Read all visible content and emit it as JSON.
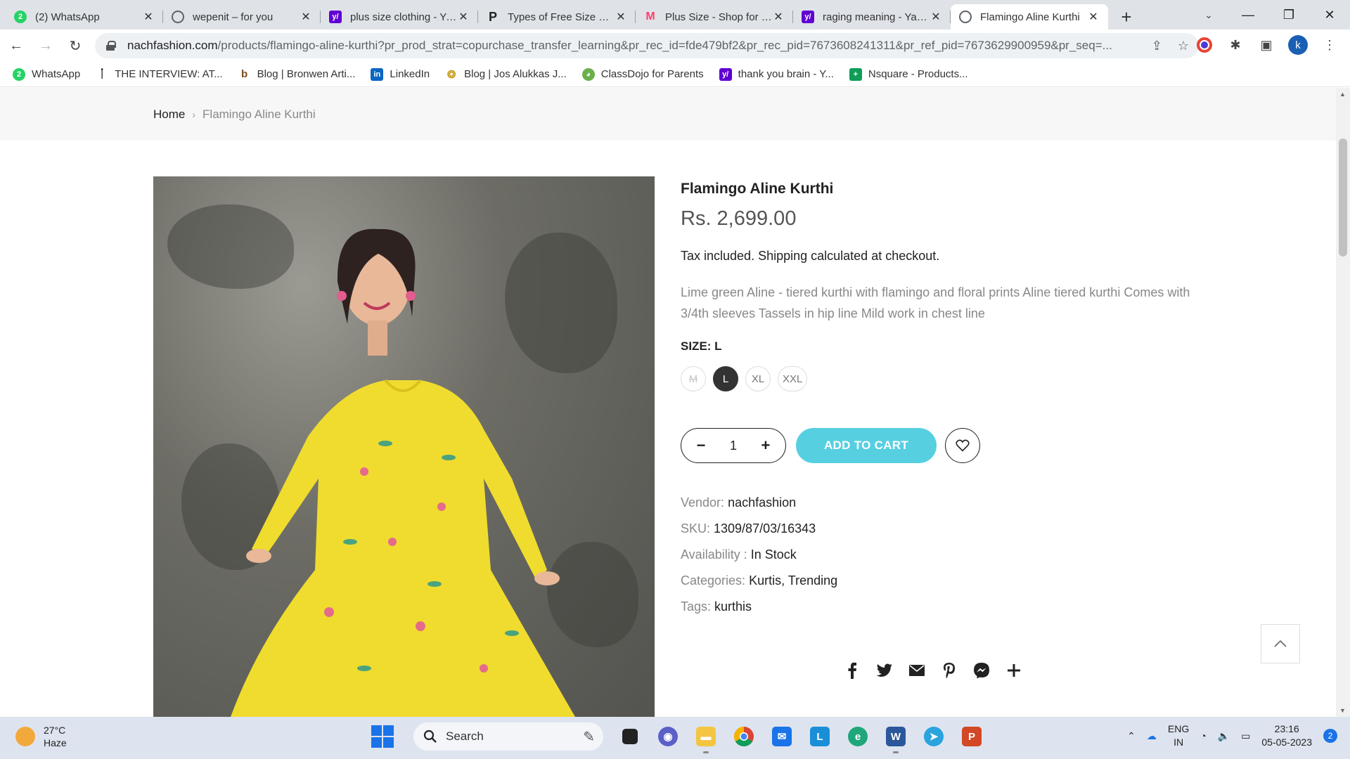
{
  "browser": {
    "tabs": [
      {
        "title": "(2) WhatsApp",
        "favicon": "whatsapp-icon",
        "color": "#25d366"
      },
      {
        "title": "wepenit – for you",
        "favicon": "globe-icon",
        "color": "#5f6368"
      },
      {
        "title": "plus size clothing - Yahoo",
        "favicon": "yahoo-icon",
        "color": "#6001d2"
      },
      {
        "title": "Types of Free Size Kurtis",
        "favicon": "pinterest-icon",
        "color": "#222222"
      },
      {
        "title": "Plus Size - Shop for Plus",
        "favicon": "myntra-icon",
        "color": "#ff3f6c"
      },
      {
        "title": "raging meaning - Yahoo",
        "favicon": "yahoo-icon",
        "color": "#6001d2"
      },
      {
        "title": "Flamingo Aline Kurthi",
        "favicon": "globe-icon",
        "color": "#5f6368"
      }
    ],
    "url_main": "nachfashion.com",
    "url_rest": "/products/flamingo-aline-kurthi?pr_prod_strat=copurchase_transfer_learning&pr_rec_id=fde479bf2&pr_rec_pid=7673608241311&pr_ref_pid=7673629900959&pr_seq=...",
    "profile_initial": "k",
    "bookmarks": [
      {
        "label": "WhatsApp",
        "icon": "whatsapp-icon",
        "color": "#25d366"
      },
      {
        "label": "THE INTERVIEW: AT...",
        "icon": "bottle-icon",
        "color": "#222222"
      },
      {
        "label": "Blog | Bronwen Arti...",
        "icon": "b-icon",
        "color": "#7a4b1e"
      },
      {
        "label": "LinkedIn",
        "icon": "linkedin-icon",
        "color": "#0a66c2"
      },
      {
        "label": "Blog | Jos Alukkas J...",
        "icon": "jewel-icon",
        "color": "#c9a227"
      },
      {
        "label": "ClassDojo for Parents",
        "icon": "classdojo-icon",
        "color": "#6ab04c"
      },
      {
        "label": "thank you brain - Y...",
        "icon": "yahoo-icon",
        "color": "#6001d2"
      },
      {
        "label": "Nsquare - Products...",
        "icon": "nsquare-icon",
        "color": "#0f9d58"
      }
    ]
  },
  "page": {
    "breadcrumb": {
      "home": "Home",
      "sep": "›",
      "current": "Flamingo Aline Kurthi"
    },
    "product": {
      "title": "Flamingo Aline Kurthi",
      "price": "Rs. 2,699.00",
      "tax_note": "Tax included. Shipping calculated at checkout.",
      "description": "Lime green Aline - tiered kurthi with flamingo and floral prints Aline tiered kurthi Comes with 3/4th sleeves Tassels in hip line Mild work in chest line",
      "size_label": "SIZE: L",
      "sizes": [
        {
          "label": "M",
          "state": "sold-out"
        },
        {
          "label": "L",
          "state": "selected"
        },
        {
          "label": "XL",
          "state": "available"
        },
        {
          "label": "XXL",
          "state": "available"
        }
      ],
      "quantity": "1",
      "add_to_cart": "ADD TO CART",
      "accent_color": "#56cfe1",
      "meta": {
        "vendor_key": "Vendor:",
        "vendor_val": "nachfashion",
        "sku_key": "SKU:",
        "sku_val": "1309/87/03/16343",
        "avail_key": "Availability :",
        "avail_val": "In Stock",
        "cat_key": "Categories:",
        "cat_val": "Kurtis, Trending",
        "tags_key": "Tags:",
        "tags_val": "kurthis"
      },
      "share_icons": [
        "facebook-icon",
        "twitter-icon",
        "email-icon",
        "pinterest-icon",
        "messenger-icon",
        "more-plus-icon"
      ]
    }
  },
  "taskbar": {
    "weather_temp": "27°C",
    "weather_desc": "Haze",
    "search_label": "Search",
    "lang_1": "ENG",
    "lang_2": "IN",
    "time": "23:16",
    "date": "05-05-2023",
    "notifications": "2"
  }
}
